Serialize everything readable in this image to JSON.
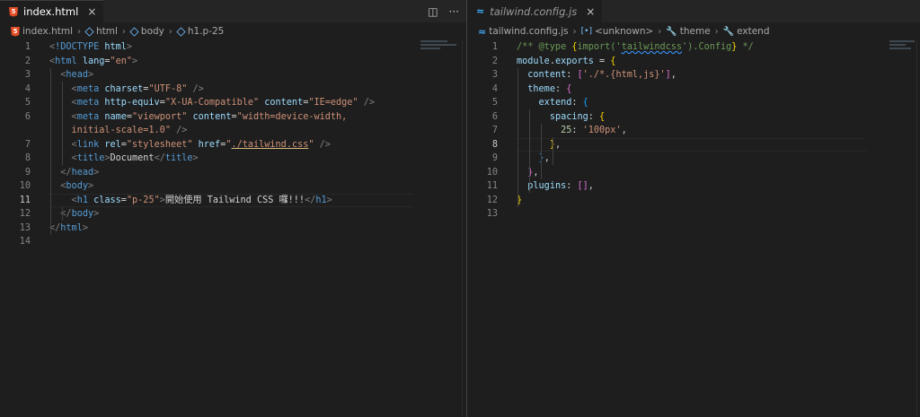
{
  "left": {
    "tab": {
      "label": "index.html",
      "icon": "html5-icon",
      "close": "×"
    },
    "breadcrumb": [
      "index.html",
      "html",
      "body",
      "h1.p-25"
    ],
    "lines": [
      {
        "n": "1",
        "parts": [
          [
            "t-bracket",
            "<"
          ],
          [
            "t-tag",
            "!DOCTYPE "
          ],
          [
            "t-attr",
            "html"
          ],
          [
            "t-bracket",
            ">"
          ]
        ]
      },
      {
        "n": "2",
        "parts": [
          [
            "t-bracket",
            "<"
          ],
          [
            "t-tag",
            "html "
          ],
          [
            "t-attr",
            "lang"
          ],
          [
            "t-txt",
            "="
          ],
          [
            "t-str",
            "\"en\""
          ],
          [
            "t-bracket",
            ">"
          ]
        ]
      },
      {
        "n": "3",
        "parts": [
          [
            "t-txt",
            "  "
          ],
          [
            "t-bracket",
            "<"
          ],
          [
            "t-tag",
            "head"
          ],
          [
            "t-bracket",
            ">"
          ]
        ]
      },
      {
        "n": "4",
        "parts": [
          [
            "t-txt",
            "    "
          ],
          [
            "t-bracket",
            "<"
          ],
          [
            "t-tag",
            "meta "
          ],
          [
            "t-attr",
            "charset"
          ],
          [
            "t-txt",
            "="
          ],
          [
            "t-str",
            "\"UTF-8\""
          ],
          [
            "t-txt",
            " "
          ],
          [
            "t-bracket",
            "/>"
          ]
        ]
      },
      {
        "n": "5",
        "parts": [
          [
            "t-txt",
            "    "
          ],
          [
            "t-bracket",
            "<"
          ],
          [
            "t-tag",
            "meta "
          ],
          [
            "t-attr",
            "http-equiv"
          ],
          [
            "t-txt",
            "="
          ],
          [
            "t-str",
            "\"X-UA-Compatible\""
          ],
          [
            "t-txt",
            " "
          ],
          [
            "t-attr",
            "content"
          ],
          [
            "t-txt",
            "="
          ],
          [
            "t-str",
            "\"IE=edge\""
          ],
          [
            "t-txt",
            " "
          ],
          [
            "t-bracket",
            "/>"
          ]
        ]
      },
      {
        "n": "6",
        "parts": [
          [
            "t-txt",
            "    "
          ],
          [
            "t-bracket",
            "<"
          ],
          [
            "t-tag",
            "meta "
          ],
          [
            "t-attr",
            "name"
          ],
          [
            "t-txt",
            "="
          ],
          [
            "t-str",
            "\"viewport\""
          ],
          [
            "t-txt",
            " "
          ],
          [
            "t-attr",
            "content"
          ],
          [
            "t-txt",
            "="
          ],
          [
            "t-str",
            "\"width=device-width,"
          ]
        ]
      },
      {
        "n": "",
        "parts": [
          [
            "t-txt",
            "    "
          ],
          [
            "t-str",
            "initial-scale=1.0\""
          ],
          [
            "t-txt",
            " "
          ],
          [
            "t-bracket",
            "/>"
          ]
        ]
      },
      {
        "n": "7",
        "parts": [
          [
            "t-txt",
            "    "
          ],
          [
            "t-bracket",
            "<"
          ],
          [
            "t-tag",
            "link "
          ],
          [
            "t-attr",
            "rel"
          ],
          [
            "t-txt",
            "="
          ],
          [
            "t-str",
            "\"stylesheet\""
          ],
          [
            "t-txt",
            " "
          ],
          [
            "t-attr",
            "href"
          ],
          [
            "t-txt",
            "="
          ],
          [
            "t-str",
            "\""
          ],
          [
            "t-str underline",
            "./tailwind.css"
          ],
          [
            "t-str",
            "\""
          ],
          [
            "t-txt",
            " "
          ],
          [
            "t-bracket",
            "/>"
          ]
        ]
      },
      {
        "n": "8",
        "parts": [
          [
            "t-txt",
            "    "
          ],
          [
            "t-bracket",
            "<"
          ],
          [
            "t-tag",
            "title"
          ],
          [
            "t-bracket",
            ">"
          ],
          [
            "t-txt",
            "Document"
          ],
          [
            "t-bracket",
            "</"
          ],
          [
            "t-tag",
            "title"
          ],
          [
            "t-bracket",
            ">"
          ]
        ]
      },
      {
        "n": "9",
        "parts": [
          [
            "t-txt",
            "  "
          ],
          [
            "t-bracket",
            "</"
          ],
          [
            "t-tag",
            "head"
          ],
          [
            "t-bracket",
            ">"
          ]
        ]
      },
      {
        "n": "10",
        "parts": [
          [
            "t-txt",
            "  "
          ],
          [
            "t-bracket",
            "<"
          ],
          [
            "t-tag",
            "body"
          ],
          [
            "t-bracket",
            ">"
          ]
        ]
      },
      {
        "n": "11",
        "parts": [
          [
            "t-txt",
            "    "
          ],
          [
            "t-bracket",
            "<"
          ],
          [
            "t-tag",
            "h1 "
          ],
          [
            "t-attr",
            "class"
          ],
          [
            "t-txt",
            "="
          ],
          [
            "t-str",
            "\"p-25\""
          ],
          [
            "t-bracket",
            ">"
          ],
          [
            "t-txt",
            "開始使用 Tailwind CSS 囉!!!"
          ],
          [
            "t-bracket",
            "</"
          ],
          [
            "t-tag",
            "h1"
          ],
          [
            "t-bracket",
            ">"
          ]
        ],
        "current": true
      },
      {
        "n": "12",
        "parts": [
          [
            "t-txt",
            "  "
          ],
          [
            "t-bracket",
            "</"
          ],
          [
            "t-tag",
            "body"
          ],
          [
            "t-bracket",
            ">"
          ]
        ]
      },
      {
        "n": "13",
        "parts": [
          [
            "t-bracket",
            "</"
          ],
          [
            "t-tag",
            "html"
          ],
          [
            "t-bracket",
            ">"
          ]
        ]
      },
      {
        "n": "14",
        "parts": []
      }
    ]
  },
  "right": {
    "tab": {
      "label": "tailwind.config.js",
      "icon": "js-config-icon",
      "close": "×"
    },
    "breadcrumb": [
      "tailwind.config.js",
      "<unknown>",
      "theme",
      "extend"
    ],
    "lines": [
      {
        "n": "1",
        "parts": [
          [
            "t-comment",
            "/** @type "
          ],
          [
            "t-b1",
            "{"
          ],
          [
            "t-comment",
            "import("
          ],
          [
            "t-comment",
            "'"
          ],
          [
            "t-comment squiggle",
            "tailwindcss"
          ],
          [
            "t-comment",
            "')"
          ],
          [
            "t-comment",
            ".Config"
          ],
          [
            "t-b1",
            "}"
          ],
          [
            "t-comment",
            " */"
          ]
        ]
      },
      {
        "n": "2",
        "parts": [
          [
            "t-prop",
            "module"
          ],
          [
            "t-punc",
            "."
          ],
          [
            "t-prop",
            "exports"
          ],
          [
            "t-punc",
            " = "
          ],
          [
            "t-b1",
            "{"
          ]
        ]
      },
      {
        "n": "3",
        "parts": [
          [
            "t-txt",
            "  "
          ],
          [
            "t-prop",
            "content"
          ],
          [
            "t-punc",
            ": "
          ],
          [
            "t-b2",
            "["
          ],
          [
            "t-str",
            "'./*.{html,js}'"
          ],
          [
            "t-b2",
            "]"
          ],
          [
            "t-punc",
            ","
          ]
        ]
      },
      {
        "n": "4",
        "parts": [
          [
            "t-txt",
            "  "
          ],
          [
            "t-prop",
            "theme"
          ],
          [
            "t-punc",
            ": "
          ],
          [
            "t-b2",
            "{"
          ]
        ]
      },
      {
        "n": "5",
        "parts": [
          [
            "t-txt",
            "    "
          ],
          [
            "t-prop",
            "extend"
          ],
          [
            "t-punc",
            ": "
          ],
          [
            "t-b3",
            "{"
          ]
        ]
      },
      {
        "n": "6",
        "parts": [
          [
            "t-txt",
            "      "
          ],
          [
            "t-prop",
            "spacing"
          ],
          [
            "t-punc",
            ": "
          ],
          [
            "t-b1",
            "{"
          ]
        ]
      },
      {
        "n": "7",
        "parts": [
          [
            "t-txt",
            "        "
          ],
          [
            "t-num",
            "25"
          ],
          [
            "t-punc",
            ": "
          ],
          [
            "t-str",
            "'100px'"
          ],
          [
            "t-punc",
            ","
          ]
        ]
      },
      {
        "n": "8",
        "parts": [
          [
            "t-txt",
            "      "
          ],
          [
            "t-b1",
            "}"
          ],
          [
            "t-punc",
            ","
          ]
        ],
        "current": true
      },
      {
        "n": "9",
        "parts": [
          [
            "t-txt",
            "    "
          ],
          [
            "t-b3",
            "}"
          ],
          [
            "t-punc",
            ","
          ]
        ]
      },
      {
        "n": "10",
        "parts": [
          [
            "t-txt",
            "  "
          ],
          [
            "t-b2",
            "}"
          ],
          [
            "t-punc",
            ","
          ]
        ]
      },
      {
        "n": "11",
        "parts": [
          [
            "t-txt",
            "  "
          ],
          [
            "t-prop",
            "plugins"
          ],
          [
            "t-punc",
            ": "
          ],
          [
            "t-b2",
            "[]"
          ],
          [
            "t-punc",
            ","
          ]
        ]
      },
      {
        "n": "12",
        "parts": [
          [
            "t-b1",
            "}"
          ]
        ]
      },
      {
        "n": "13",
        "parts": []
      }
    ]
  }
}
